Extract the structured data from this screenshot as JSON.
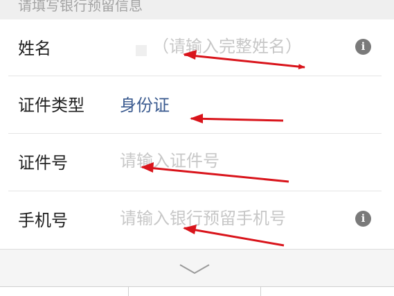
{
  "section": {
    "title": "请填写银行预留信息"
  },
  "form": {
    "name": {
      "label": "姓名",
      "placeholder": "（请输入完整姓名）",
      "info_icon": "info-icon"
    },
    "id_type": {
      "label": "证件类型",
      "value": "身份证"
    },
    "id_number": {
      "label": "证件号",
      "placeholder": "请输入证件号"
    },
    "phone": {
      "label": "手机号",
      "placeholder": "请输入银行预留手机号",
      "info_icon": "info-icon"
    }
  },
  "keyboard": {
    "collapse_icon": "chevron-down-icon"
  },
  "annotations": {
    "color": "#d9141b",
    "shape": "arrow"
  },
  "colors": {
    "label": "#1f1f1f",
    "placeholder": "#c7c7c7",
    "link_value": "#3a5a8f",
    "icon": "#7a7a7a"
  }
}
